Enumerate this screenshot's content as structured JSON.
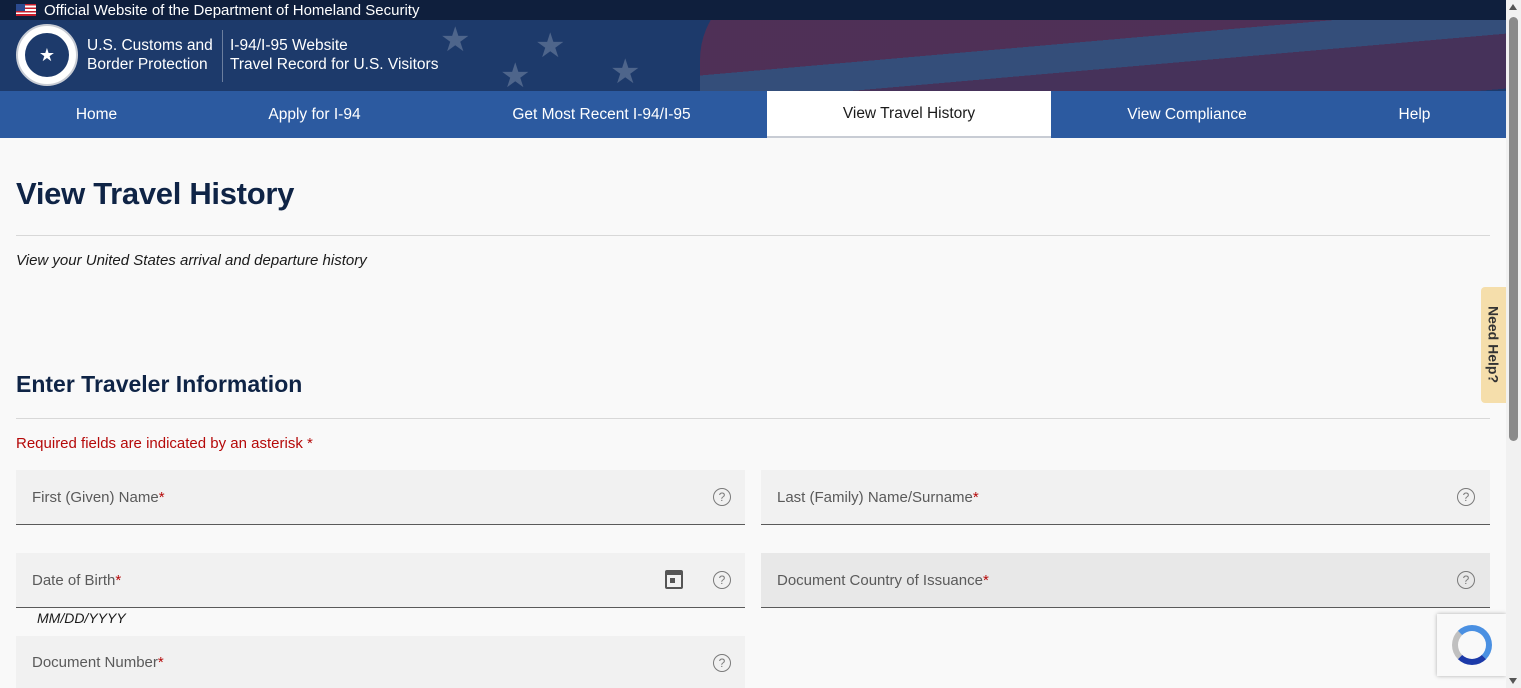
{
  "gov_banner": {
    "text": "Official Website of the Department of Homeland Security",
    "flag_icon": "us-flag-icon"
  },
  "header": {
    "agency_line1": "U.S. Customs and",
    "agency_line2": "Border Protection",
    "site_line1": "I-94/I-95 Website",
    "site_line2": "Travel Record for U.S. Visitors",
    "seal_icon": "cbp-seal-icon"
  },
  "nav": {
    "items": [
      {
        "label": "Home"
      },
      {
        "label": "Apply for I-94"
      },
      {
        "label": "Get Most Recent I-94/I-95"
      },
      {
        "label": "View Travel History",
        "active": true
      },
      {
        "label": "View Compliance"
      },
      {
        "label": "Help"
      }
    ]
  },
  "page": {
    "title": "View Travel History",
    "subtitle": "View your United States arrival and departure history",
    "section_title": "Enter Traveler Information",
    "required_note": "Required fields are indicated by an asterisk *"
  },
  "form": {
    "first_name": {
      "label": "First (Given) Name",
      "asterisk": "*"
    },
    "last_name": {
      "label": "Last (Family) Name/Surname",
      "asterisk": "*"
    },
    "dob": {
      "label": "Date of Birth",
      "asterisk": "*",
      "hint": "MM/DD/YYYY"
    },
    "country": {
      "label": "Document Country of Issuance",
      "asterisk": "*"
    },
    "doc_number": {
      "label": "Document Number",
      "asterisk": "*"
    },
    "help_glyph": "?"
  },
  "side": {
    "need_help": "Need Help?"
  },
  "colors": {
    "navy": "#0f2446",
    "nav_blue": "#2c5aa0",
    "required_red": "#b50909",
    "help_tab": "#f5deab"
  }
}
